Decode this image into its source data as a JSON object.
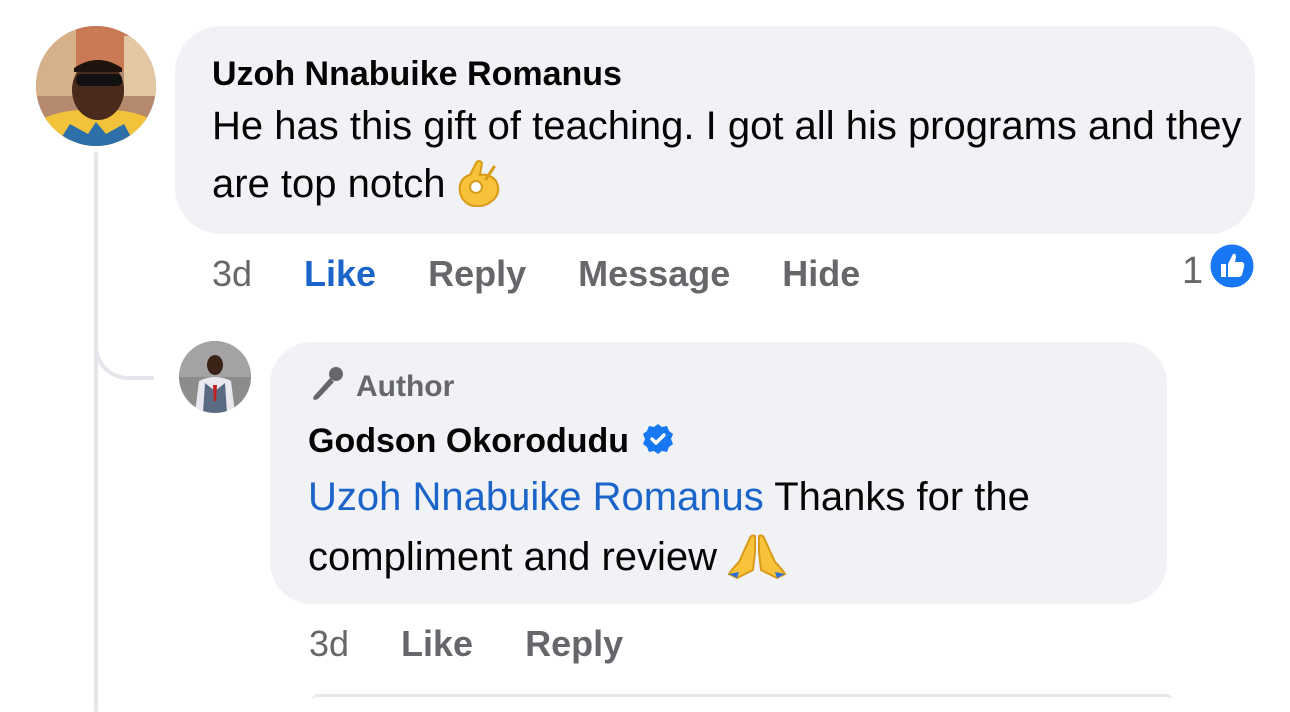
{
  "comment": {
    "author": "Uzoh Nnabuike Romanus",
    "text": "He has this gift of teaching. I got all his programs and they are top notch",
    "emoji": "ok-hand-emoji",
    "time": "3d",
    "actions": {
      "like": "Like",
      "reply": "Reply",
      "message": "Message",
      "hide": "Hide"
    },
    "reaction_count": "1",
    "reaction_icon": "like-reaction-icon"
  },
  "reply": {
    "badge": "Author",
    "author": "Godson Okorodudu",
    "verified": true,
    "mention": "Uzoh Nnabuike Romanus",
    "text": " Thanks for the compliment and review",
    "emoji": "folded-hands-emoji",
    "time": "3d",
    "actions": {
      "like": "Like",
      "reply": "Reply"
    }
  },
  "colors": {
    "bubble": "#f0f2f5",
    "link": "#1b64c9",
    "muted": "#65676b",
    "verified": "#1877f2"
  }
}
